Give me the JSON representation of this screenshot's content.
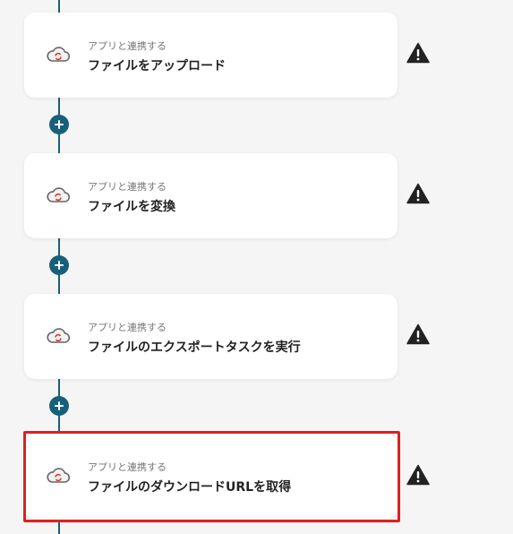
{
  "flow": {
    "steps": [
      {
        "subtitle": "アプリと連携する",
        "title": "ファイルをアップロード",
        "icon": "cloud-sync-icon",
        "status": "warning-icon"
      },
      {
        "subtitle": "アプリと連携する",
        "title": "ファイルを変換",
        "icon": "cloud-sync-icon",
        "status": "warning-icon"
      },
      {
        "subtitle": "アプリと連携する",
        "title": "ファイルのエクスポートタスクを実行",
        "icon": "cloud-sync-icon",
        "status": "warning-icon"
      },
      {
        "subtitle": "アプリと連携する",
        "title": "ファイルのダウンロードURLを取得",
        "icon": "cloud-sync-icon",
        "status": "warning-icon"
      }
    ],
    "add_button_icon": "plus-icon",
    "highlighted_step": 4
  },
  "colors": {
    "connector": "#16607a",
    "highlight": "#e0201e",
    "card_bg": "#ffffff",
    "page_bg": "#f5f5f5",
    "warning": "#222222"
  }
}
